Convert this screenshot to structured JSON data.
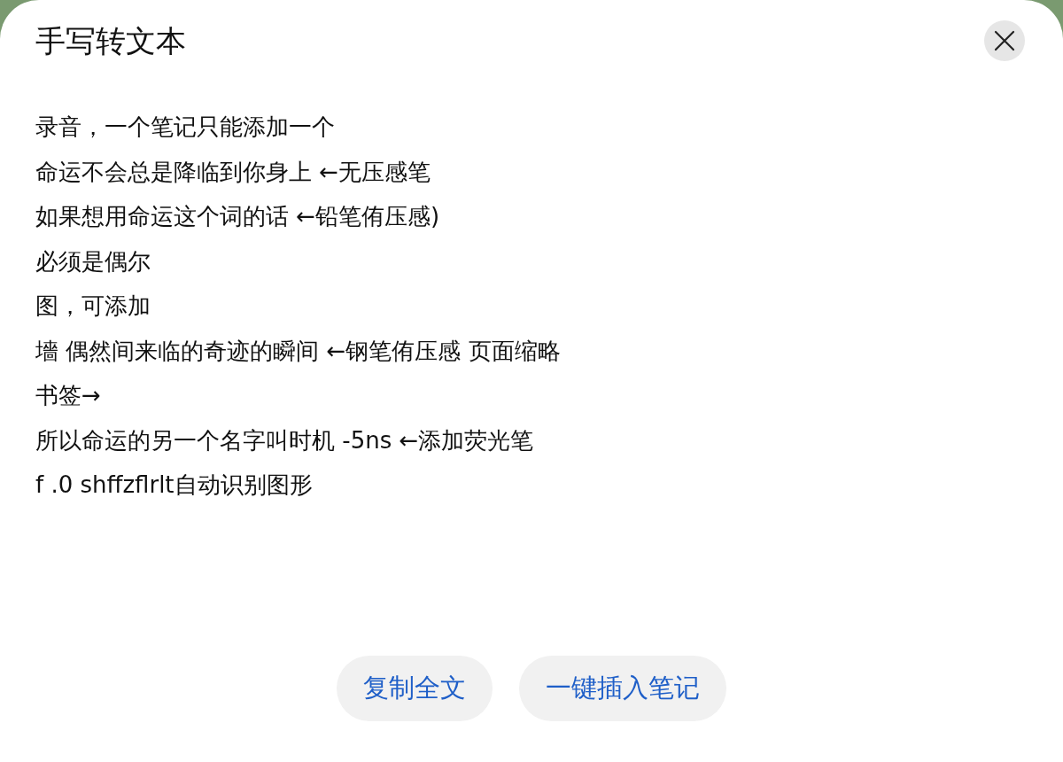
{
  "dialog": {
    "title": "手写转文本"
  },
  "lines": [
    "录音，一个笔记只能添加一个",
    "命运不会总是降临到你身上 ←无压感笔",
    "如果想用命运这个词的话 ←铅笔侑压感)",
    "必须是偶尔",
    "图，可添加",
    "墻 偶然间来临的奇迹的瞬间 ←钢笔侑压感 页面缩略",
    "书签→",
    "所以命运的另一个名字叫时机 -5ns ←添加荧光笔",
    "f .0 shffzflrlt自动识别图形"
  ],
  "buttons": [
    "复制全文",
    "一键插入笔记"
  ]
}
